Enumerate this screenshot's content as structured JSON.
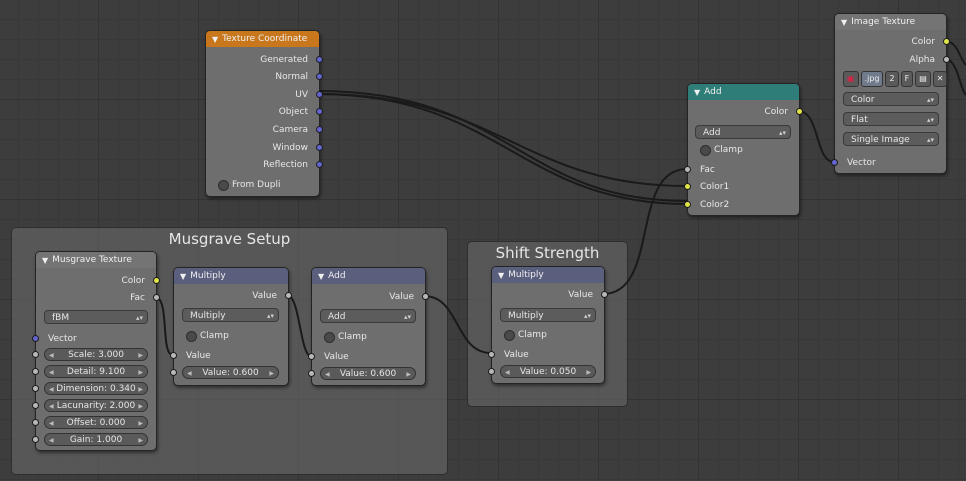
{
  "nodes": {
    "texture_coordinate": {
      "title": "Texture Coordinate",
      "outputs": [
        "Generated",
        "Normal",
        "UV",
        "Object",
        "Camera",
        "Window",
        "Reflection"
      ],
      "from_dupli": "From Dupli"
    },
    "add_top": {
      "title": "Add",
      "output": "Color",
      "blend_mode": "Add",
      "clamp": "Clamp",
      "inputs": [
        "Fac",
        "Color1",
        "Color2"
      ]
    },
    "image_texture": {
      "title": "Image Texture",
      "outputs": [
        "Color",
        "Alpha"
      ],
      "image_name": ".jpg",
      "users": "2",
      "fake": "F",
      "color_space": "Color",
      "projection": "Flat",
      "source": "Single Image",
      "input": "Vector"
    },
    "musgrave": {
      "title": "Musgrave Texture",
      "outputs": [
        "Color",
        "Fac"
      ],
      "type": "fBM",
      "vector": "Vector",
      "fields": [
        "Scale: 3.000",
        "Detail: 9.100",
        "Dimension: 0.340",
        "Lacunarity: 2.000",
        "Offset: 0.000",
        "Gain: 1.000"
      ]
    },
    "multiply_1": {
      "title": "Multiply",
      "output": "Value",
      "operation": "Multiply",
      "clamp": "Clamp",
      "input": "Value",
      "value_field": "Value: 0.600"
    },
    "add_math": {
      "title": "Add",
      "output": "Value",
      "operation": "Add",
      "clamp": "Clamp",
      "input": "Value",
      "value_field": "Value: 0.600"
    },
    "multiply_2": {
      "title": "Multiply",
      "output": "Value",
      "operation": "Multiply",
      "clamp": "Clamp",
      "input": "Value",
      "value_field": "Value: 0.050"
    }
  },
  "frames": {
    "musgrave_setup": "Musgrave Setup",
    "shift_strength": "Shift Strength"
  },
  "colors": {
    "header_texture_coordinate": "#c8771c",
    "header_mix": "#2f7d78",
    "header_math": "#5b5f7e",
    "socket_color": "#e0e44a",
    "socket_float": "#b8b8b8",
    "socket_vector": "#6464d0"
  },
  "icons": {
    "node_collapse": "triangle-down-icon",
    "image_browse": "image-icon",
    "fake_user": "save-icon",
    "unlink": "x-icon"
  }
}
